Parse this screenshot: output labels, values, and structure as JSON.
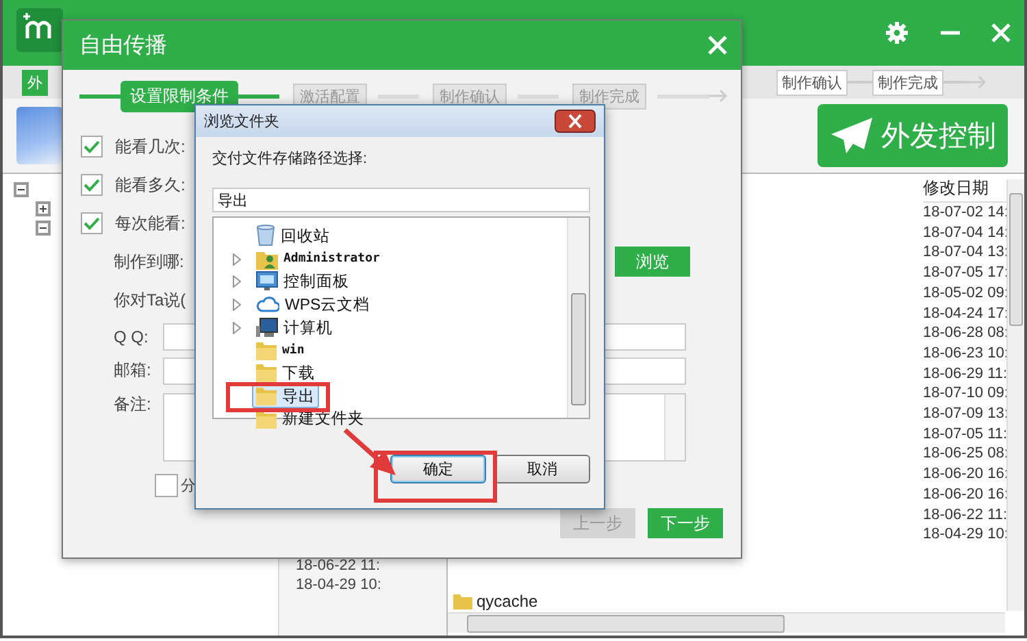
{
  "main_window": {
    "steps": [
      {
        "label": "外"
      },
      {
        "label": "制作确认"
      },
      {
        "label": "制作完成"
      }
    ],
    "action_button": "外发控制",
    "file_list": {
      "column": "修改日期",
      "dates": [
        "18-07-02 14:",
        "18-07-04 14:",
        "18-07-04 13:",
        "18-07-05 17:",
        "18-05-02 09:",
        "18-04-24 17:",
        "18-06-28 08:",
        "18-06-23 10:",
        "18-06-29 11:",
        "18-07-10 09:",
        "18-07-09 13:",
        "18-07-05 11:",
        "18-06-25 08:",
        "18-06-20 16:",
        "18-06-20 16:",
        "18-06-22 11:",
        "18-04-29 10:"
      ]
    },
    "background_dates": [
      "18-06-22 11:",
      "18-04-29 10:"
    ],
    "folder_item": "qycache"
  },
  "dialog": {
    "title": "自由传播",
    "steps": [
      {
        "label": "设置限制条件",
        "selected": true
      },
      {
        "label": "激活配置",
        "selected": false
      },
      {
        "label": "制作确认",
        "selected": false
      },
      {
        "label": "制作完成",
        "selected": false
      }
    ],
    "options": [
      {
        "label": "能看几次:",
        "checked": true
      },
      {
        "label": "能看多久:",
        "checked": true
      },
      {
        "label": "每次能看:",
        "checked": true
      }
    ],
    "target_label": "制作到哪:",
    "browse_button": "浏览",
    "message_label": "你对Ta说(",
    "fields": [
      {
        "label": "Q Q:"
      },
      {
        "label": "邮箱:"
      }
    ],
    "note_label": "备注:",
    "share": {
      "label": "分",
      "checked": false
    },
    "buttons": [
      {
        "label": "上一步",
        "disabled": true
      },
      {
        "label": "下一步",
        "disabled": false
      }
    ]
  },
  "folder_dialog": {
    "title": "浏览文件夹",
    "prompt": "交付文件存储路径选择:",
    "path": "导出",
    "tree": [
      {
        "kind": "recycle",
        "label": "回收站",
        "expandable": false,
        "selected": false
      },
      {
        "kind": "user",
        "label": "Administrator",
        "expandable": true,
        "selected": false
      },
      {
        "kind": "panel",
        "label": "控制面板",
        "expandable": true,
        "selected": false
      },
      {
        "kind": "cloud",
        "label": "WPS云文档",
        "expandable": true,
        "selected": false
      },
      {
        "kind": "computer",
        "label": "计算机",
        "expandable": true,
        "selected": false
      },
      {
        "kind": "folder",
        "label": "win",
        "expandable": false,
        "selected": false
      },
      {
        "kind": "folder",
        "label": "下载",
        "expandable": false,
        "selected": false
      },
      {
        "kind": "folder",
        "label": "导出",
        "expandable": false,
        "selected": true
      },
      {
        "kind": "folder",
        "label": "新建文件夹",
        "expandable": false,
        "selected": false
      }
    ],
    "buttons": [
      {
        "label": "确定",
        "default": true
      },
      {
        "label": "取消",
        "default": false
      }
    ]
  }
}
